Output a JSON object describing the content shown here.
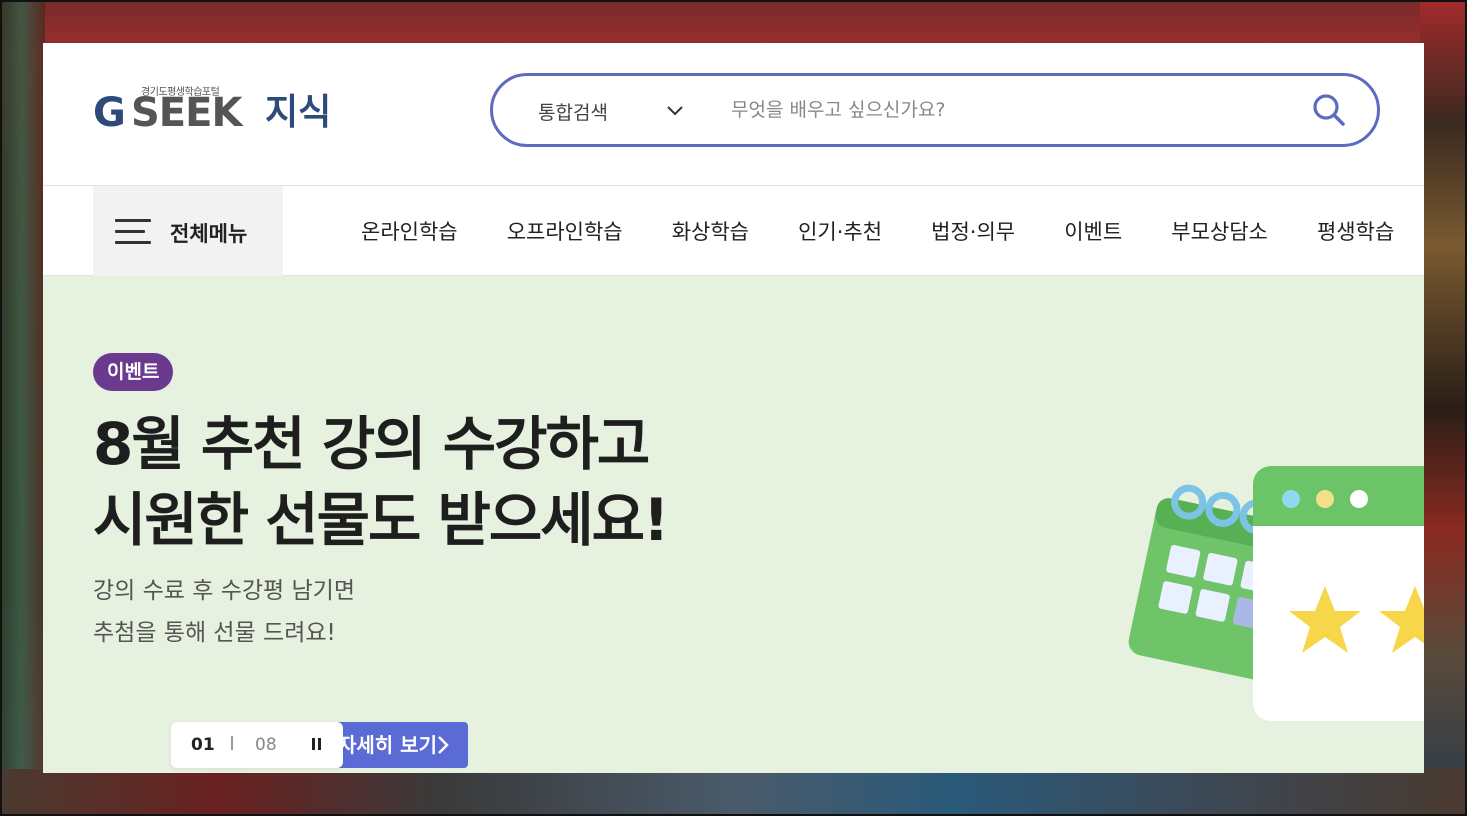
{
  "logo": {
    "tagline": "경기도평생학습포털",
    "g_mark": "G",
    "seek": "SEEK",
    "jisik": "지식"
  },
  "search": {
    "category_label": "통합검색",
    "placeholder": "무엇을 배우고 싶으신가요?",
    "value": ""
  },
  "nav": {
    "all_menu_label": "전체메뉴",
    "items": [
      {
        "label": "온라인학습"
      },
      {
        "label": "오프라인학습"
      },
      {
        "label": "화상학습"
      },
      {
        "label": "인기·추천"
      },
      {
        "label": "법정·의무"
      },
      {
        "label": "이벤트"
      },
      {
        "label": "부모상담소"
      },
      {
        "label": "평생학습"
      }
    ]
  },
  "hero": {
    "badge": "이벤트",
    "title_line1": "8월 추천 강의 수강하고",
    "title_line2": "시원한 선물도 받으세요!",
    "sub_line1": "강의 수료 후 수강평 남기면",
    "sub_line2": "추첨을 통해 선물 드려요!",
    "detail_button": "자세히 보기",
    "pager": {
      "current": "01",
      "total": "08"
    }
  },
  "colors": {
    "accent": "#5c6bc0",
    "badge": "#6b3a8e",
    "hero_bg": "#e6f1df",
    "detail_button": "#5a6bd6",
    "logo_blue": "#2d4a7a"
  },
  "icons": {
    "search": "search-icon",
    "chevron": "chevron-down-icon",
    "menu": "hamburger-icon",
    "pause": "pause-icon",
    "arrow": "chevron-right-icon",
    "illustration": "calendar-stars-illustration"
  }
}
